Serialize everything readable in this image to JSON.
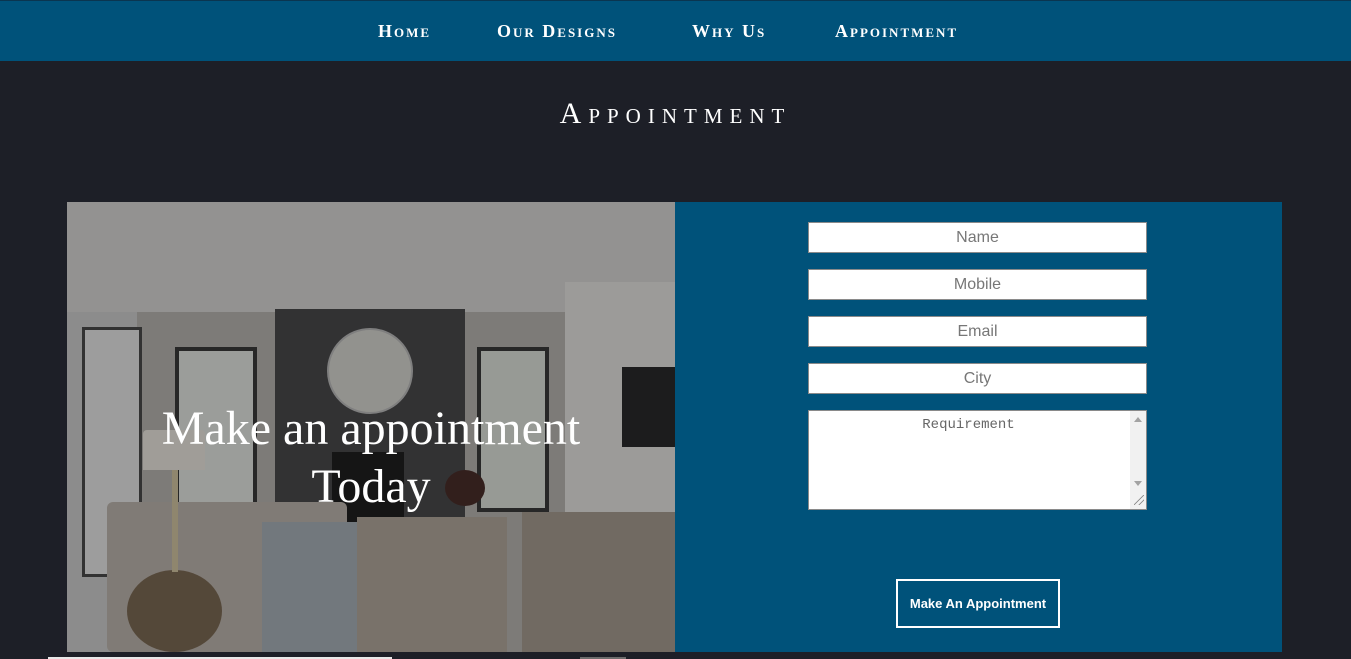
{
  "nav": {
    "items": [
      {
        "label": "Home"
      },
      {
        "label": "Our Designs"
      },
      {
        "label": "Why Us"
      },
      {
        "label": "Appointment"
      }
    ]
  },
  "section": {
    "title": "Appointment"
  },
  "hero": {
    "line1": "Make an appointment",
    "line2": "Today"
  },
  "form": {
    "name_placeholder": "Name",
    "mobile_placeholder": "Mobile",
    "email_placeholder": "Email",
    "city_placeholder": "City",
    "requirement_placeholder": "Requirement",
    "submit_label": "Make An Appointment"
  },
  "colors": {
    "nav_background": "#00527a",
    "page_background": "#1d1f27",
    "form_background": "#00527a"
  }
}
